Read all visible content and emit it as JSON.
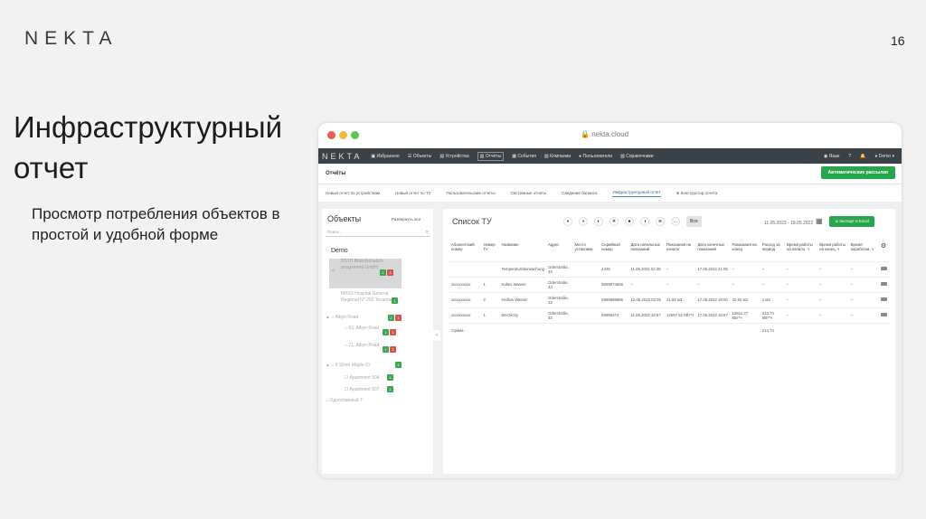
{
  "slide": {
    "logo": "NEKTA",
    "page": "16",
    "title": "Инфраструктурный отчет",
    "desc": "Просмотр потребления объектов в простой и удобной форме"
  },
  "browser": {
    "url": "nekta.cloud",
    "dots": [
      "#ee5a52",
      "#f5b940",
      "#5fc44f"
    ]
  },
  "nav": {
    "logo": "NEKTA",
    "items": [
      "Избранное",
      "Объекты",
      "Устройства",
      "Отчёты",
      "События",
      "Компании",
      "Пользователи",
      "Справочники"
    ],
    "active": 3,
    "user_short": "Язык",
    "user": "Demo"
  },
  "app": {
    "header": "Отчёты",
    "auto_button": "Автоматические рассылки",
    "tabs": [
      "Новый отчет по устройствам",
      "Новый отчет по ТУ",
      "Пользовательские отчеты",
      "Системные отчеты",
      "Сведение баланса",
      "Инфраструктурный отчёт",
      "Конструктор отчёта"
    ],
    "active_tab": 5
  },
  "tree": {
    "title": "Объекты",
    "expand": "Развернуть все",
    "search": "Поиск...",
    "root": "Demo",
    "nodes": [
      {
        "label": "BSTH Brandschutzm anagement GmbH",
        "badges": [
          "1",
          "3"
        ],
        "selected": true
      },
      {
        "label": "NHSS Hospital General Regional N° 200 Tecamac",
        "badges": [
          "1"
        ]
      },
      {
        "label": "Albyn Road",
        "badges": [
          "2",
          "1"
        ]
      },
      {
        "label": "63, Albyn Road",
        "badges": [
          "1",
          "1"
        ]
      },
      {
        "label": "71, Albyn Road",
        "badges": [
          "1",
          "1"
        ]
      },
      {
        "label": "6 Silver Maple Ct",
        "badges": [
          "1"
        ]
      },
      {
        "label": "Apartment 504",
        "badges": [
          "1"
        ]
      },
      {
        "label": "Apartment 507",
        "badges": [
          "1"
        ]
      },
      {
        "label": "Одноэтажный 7",
        "badges": []
      }
    ]
  },
  "main": {
    "title": "Список ТУ",
    "vse": "Все",
    "date": "11.05.2022 - 18.05.2022",
    "export": "Экспорт в Excel",
    "columns": [
      "Абонентский номер",
      "Номер ТУ",
      "Название",
      "Адрес",
      "Место установки",
      "Серийный номер",
      "Дата начальных показаний",
      "Показания на начало",
      "Дата конечных показаний",
      "Показания на конец",
      "Расход за период",
      "Время работы на начало, ч",
      "Время работы на конец, ч",
      "Время наработки, ч"
    ],
    "rows": [
      [
        "",
        "",
        "Temperaturüberwachung",
        "Oderstraße, 43",
        "",
        "4425",
        "11.05.2022 02:35",
        "–",
        "17.05.2022 21:05",
        "–",
        "–",
        "–",
        "–",
        "–"
      ],
      [
        "xxxxxxxxxx",
        "1",
        "Kaltes Wasser",
        "Oderstraße, 43",
        "",
        "5689874566",
        "–",
        "–",
        "–",
        "–",
        "–",
        "–",
        "–",
        "–"
      ],
      [
        "xxxxxxxxxx",
        "2",
        "Heißes Wasser",
        "Oderstraße, 43",
        "",
        "5989898986",
        "12.05.2022 02:35",
        "31.82 м3",
        "17.05.2022 19:00",
        "32.82 м3",
        "1 м3",
        "–",
        "–",
        "–"
      ],
      [
        "xxxxxxxxxx",
        "1",
        "Electricity",
        "Oderstraße, 43",
        "",
        "85896374",
        "11.05.2022 18:57",
        "12697.52 КВт*ч",
        "17.05.2022 18:57",
        "12911.27 КВт*ч",
        "213.74 КВт*ч",
        "–",
        "–",
        "–"
      ]
    ],
    "sum_label": "Сумма",
    "sum_value": "214.74"
  }
}
